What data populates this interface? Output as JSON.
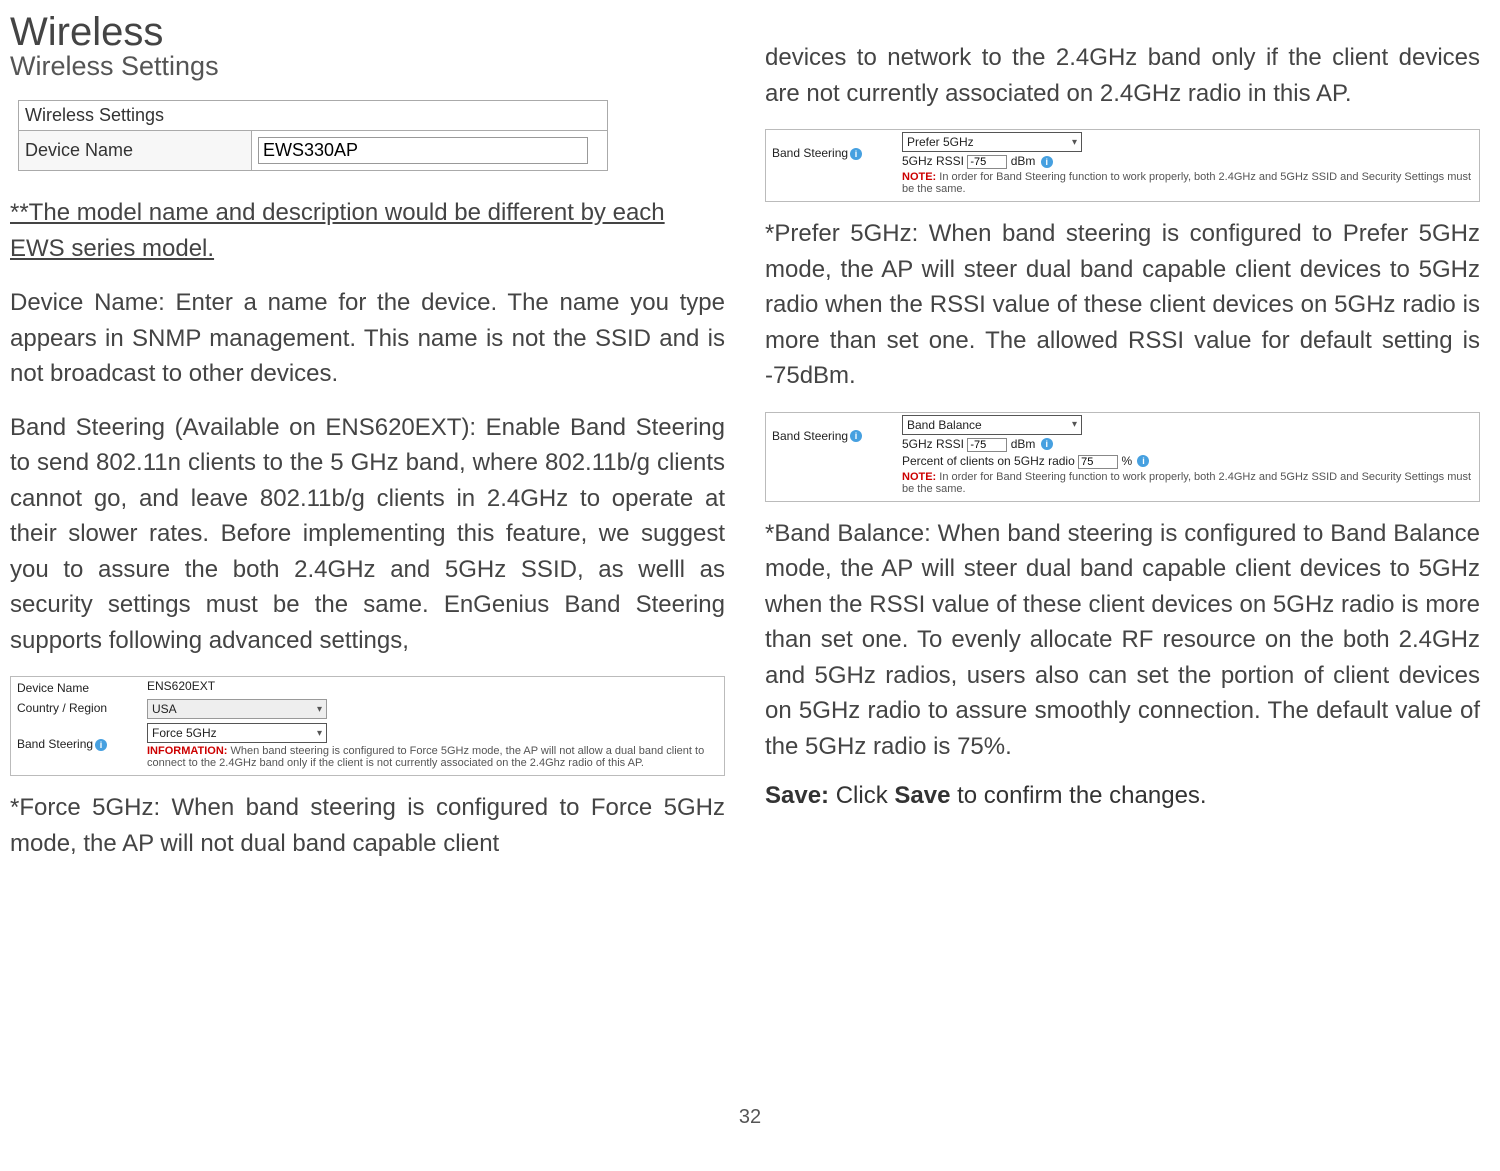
{
  "left": {
    "title": "Wireless",
    "subtitle": "Wireless Settings",
    "ws_box": {
      "header": "Wireless Settings",
      "row_label": "Device Name",
      "row_value": "EWS330AP"
    },
    "model_note": "**The model name and description would be different by each EWS series model.",
    "device_name_para": "Device Name: Enter a name for the device. The name you type appears in SNMP management. This name is not the SSID and is not broadcast to other devices.",
    "band_steering_para": "Band Steering (Available on ENS620EXT): Enable Band Steering to send 802.11n clients to the 5 GHz band, where 802.11b/g clients cannot go, and leave 802.11b/g clients in 2.4GHz to operate at their slower rates. Before implementing this feature, we suggest you to assure the both 2.4GHz and 5GHz SSID, as welll as security settings must be the same. EnGenius Band Steering supports following advanced settings,",
    "ui_force": {
      "device_label": "Device Name",
      "device_value": "ENS620EXT",
      "country_label": "Country / Region",
      "country_value": "USA",
      "bs_label": "Band Steering",
      "bs_value": "Force 5GHz",
      "info_label": "INFORMATION:",
      "info_text": "When band steering is configured to Force 5GHz mode, the AP will not allow a dual band client to connect to the 2.4GHz band only if the client is not currently associated on the 2.4Ghz radio of this AP."
    },
    "force_para": "*Force 5GHz: When band steering is configured to Force 5GHz mode, the AP will not dual band capable client"
  },
  "right": {
    "cont_para": "devices to network to the 2.4GHz band only if the client devices are not currently associated on 2.4GHz radio in this AP.",
    "ui_prefer": {
      "bs_label": "Band Steering",
      "bs_value": "Prefer 5GHz",
      "rssi_label": "5GHz RSSI",
      "rssi_value": "-75",
      "rssi_unit": "dBm",
      "note_label": "NOTE:",
      "note_text": "In order for Band Steering function to work properly, both 2.4GHz and 5GHz SSID and Security Settings must be the same."
    },
    "prefer_para": " *Prefer 5GHz: When band steering is configured to Prefer 5GHz  mode, the AP will steer dual band capable client devices to 5GHz radio when the RSSI value of these client devices on 5GHz radio is more than set one. The allowed RSSI value for default setting is -75dBm.",
    "ui_balance": {
      "bs_label": "Band Steering",
      "bs_value": "Band Balance",
      "rssi_label": "5GHz RSSI",
      "rssi_value": "-75",
      "rssi_unit": "dBm",
      "percent_label": "Percent of clients on 5GHz radio",
      "percent_value": "75",
      "percent_unit": "%",
      "note_label": "NOTE:",
      "note_text": "In order for Band Steering function to work properly, both 2.4GHz and 5GHz SSID and Security Settings must be the same."
    },
    "balance_para": "  *Band Balance: When band steering is configured to Band Balance mode, the AP will steer dual band capable client devices to 5GHz when the RSSI value of these client devices on 5GHz radio is more than set one. To evenly allocate RF resource on the both 2.4GHz and 5GHz radios, users also can set the portion of client devices on 5GHz radio to assure smoothly connection. The default value of the 5GHz radio is 75%.",
    "save_prefix": "Save:",
    "save_mid": " Click ",
    "save_word": "Save",
    "save_suffix": " to confirm the changes."
  },
  "page_number": "32"
}
